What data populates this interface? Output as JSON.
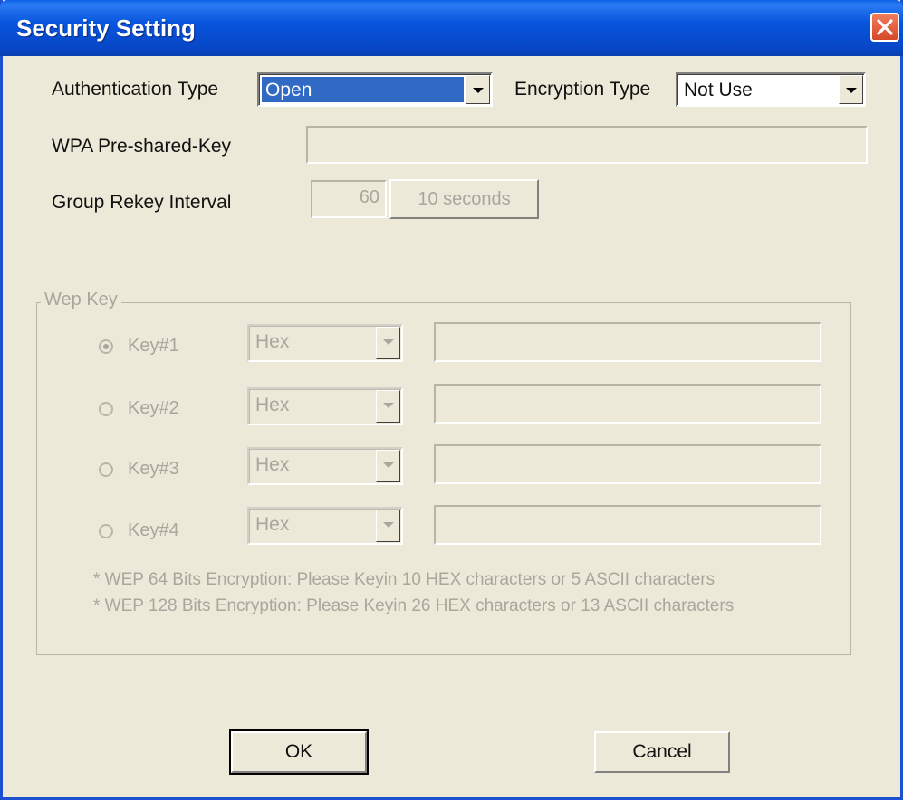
{
  "window": {
    "title": "Security Setting"
  },
  "auth": {
    "label": "Authentication Type",
    "value": "Open"
  },
  "encryption": {
    "label": "Encryption Type",
    "value": "Not Use"
  },
  "wpa": {
    "label": "WPA Pre-shared-Key",
    "value": ""
  },
  "rekey": {
    "label": "Group Rekey Interval",
    "value": "60",
    "unit_button": "10 seconds"
  },
  "wep": {
    "legend": "Wep Key",
    "keys": [
      {
        "label": "Key#1",
        "format": "Hex",
        "checked": true
      },
      {
        "label": "Key#2",
        "format": "Hex",
        "checked": false
      },
      {
        "label": "Key#3",
        "format": "Hex",
        "checked": false
      },
      {
        "label": "Key#4",
        "format": "Hex",
        "checked": false
      }
    ],
    "note1": "* WEP  64 Bits Encryption:  Please Keyin 10 HEX characters or  5 ASCII characters",
    "note2": "* WEP 128 Bits Encryption:  Please Keyin 26 HEX characters or 13 ASCII characters"
  },
  "buttons": {
    "ok": "OK",
    "cancel": "Cancel"
  },
  "colors": {
    "titlebar": "#0855dd",
    "selection": "#316ac5",
    "dialog_bg": "#ece9d8",
    "disabled_text": "#a9a79d"
  },
  "icons": {
    "close": "close-icon",
    "dropdown": "chevron-down-icon"
  }
}
